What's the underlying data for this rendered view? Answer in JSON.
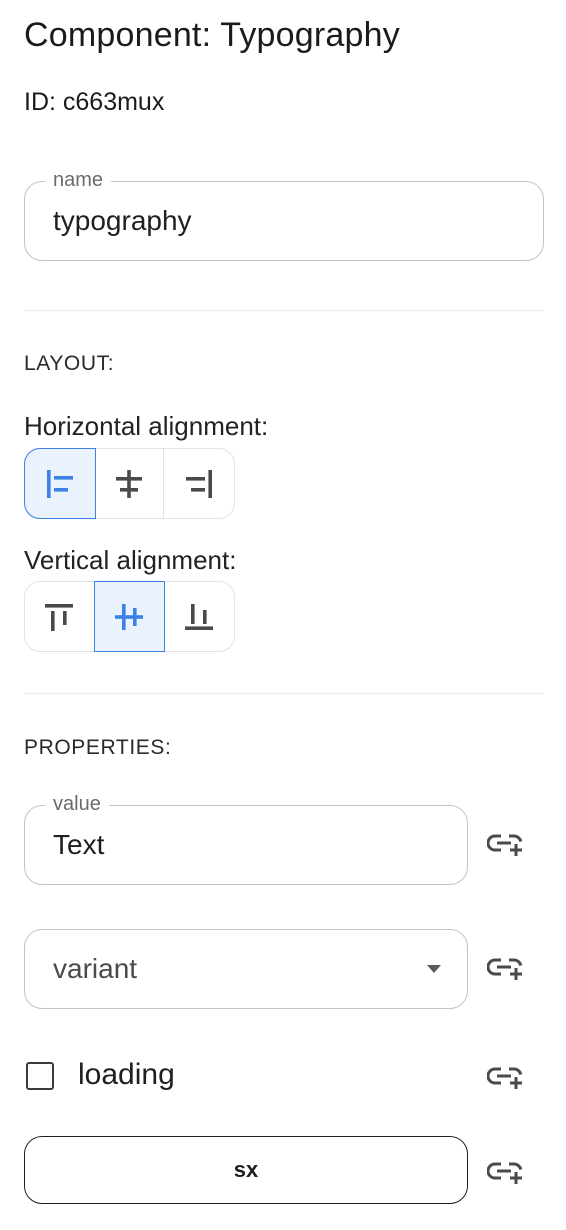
{
  "header": {
    "title": "Component: Typography",
    "id_text": "ID: c663mux"
  },
  "name_field": {
    "label": "name",
    "value": "typography"
  },
  "layout": {
    "section_label": "LAYOUT:",
    "horizontal": {
      "label": "Horizontal alignment:",
      "options": [
        "align-left-icon",
        "align-center-horizontal-icon",
        "align-right-icon"
      ],
      "selected_index": 0
    },
    "vertical": {
      "label": "Vertical alignment:",
      "options": [
        "align-top-icon",
        "align-middle-vertical-icon",
        "align-bottom-icon"
      ],
      "selected_index": 1
    }
  },
  "properties": {
    "section_label": "PROPERTIES:",
    "value_field": {
      "label": "value",
      "value": "Text"
    },
    "variant_select": {
      "placeholder": "variant"
    },
    "loading_checkbox": {
      "label": "loading",
      "checked": false
    },
    "sx_button": {
      "label": "sx"
    },
    "binding_icon": "add-link-icon"
  },
  "colors": {
    "accent": "#3c82e6",
    "accent_bg": "#eaf2fd",
    "border": "#c4c4c4",
    "icon": "#4a4a4a"
  }
}
